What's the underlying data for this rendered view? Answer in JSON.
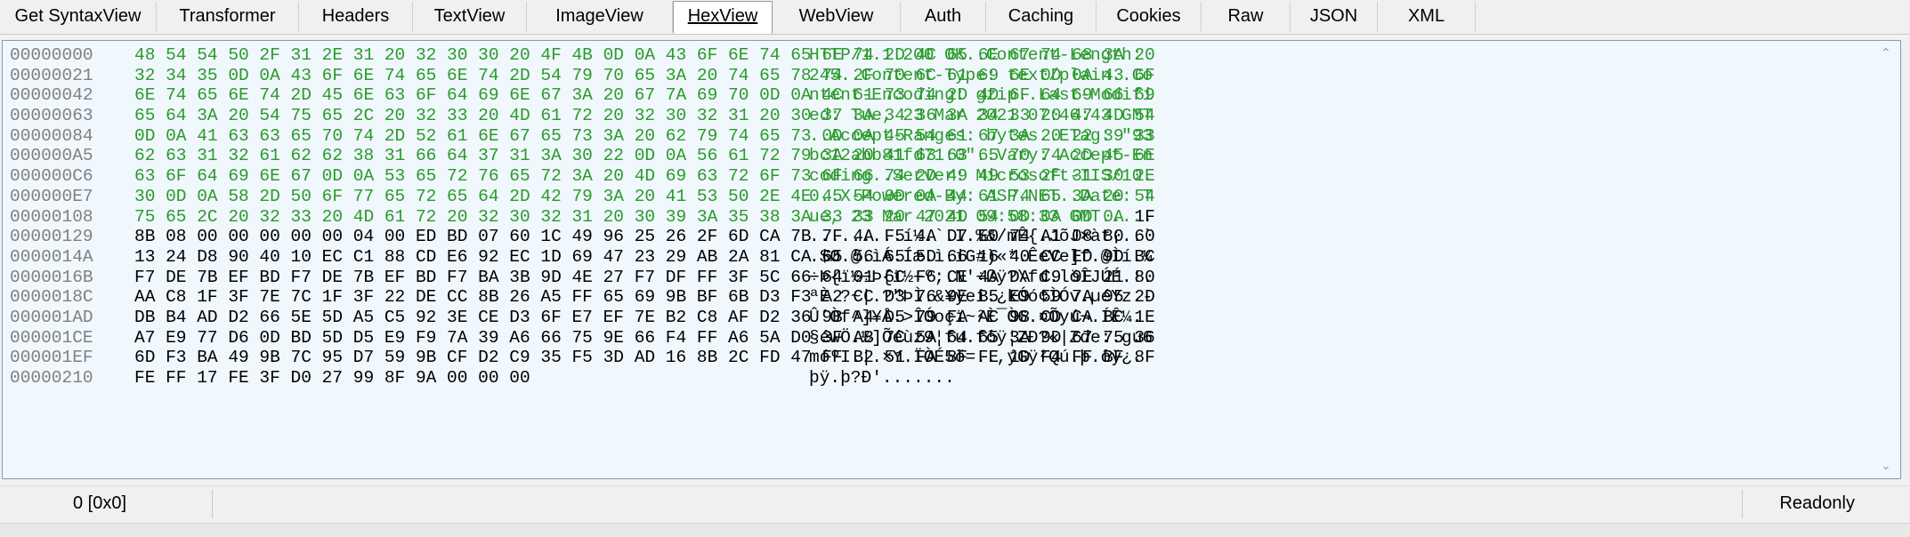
{
  "tabs": [
    {
      "label": "Get SyntaxView",
      "active": false
    },
    {
      "label": "Transformer",
      "active": false
    },
    {
      "label": "Headers",
      "active": false
    },
    {
      "label": "TextView",
      "active": false
    },
    {
      "label": "ImageView",
      "active": false
    },
    {
      "label": "HexView",
      "active": true
    },
    {
      "label": "WebView",
      "active": false
    },
    {
      "label": "Auth",
      "active": false
    },
    {
      "label": "Caching",
      "active": false
    },
    {
      "label": "Cookies",
      "active": false
    },
    {
      "label": "Raw",
      "active": false
    },
    {
      "label": "JSON",
      "active": false
    },
    {
      "label": "XML",
      "active": false
    }
  ],
  "colors": {
    "header_bytes": "#2a9a2a",
    "body_bytes": "#000000",
    "offset": "#808080",
    "panel_bg": "#f0f7fd"
  },
  "hex_rows": [
    {
      "offset": "00000000",
      "hex": "48 54 54 50 2F 31 2E 31 20 32 30 30 20 4F 4B 0D 0A 43 6F 6E 74 65 6E 74 2D 4C 65 6E 67 74 68 3A 20",
      "ascii": "HTTP/1.1 200 OK..Content-Length: ",
      "part": "hdr"
    },
    {
      "offset": "00000021",
      "hex": "32 34 35 0D 0A 43 6F 6E 74 65 6E 74 2D 54 79 70 65 3A 20 74 65 78 74 2F 70 6C 61 69 6E 0D 0A 43 6F",
      "ascii": "245..Content-Type: text/plain..Co",
      "part": "hdr"
    },
    {
      "offset": "00000042",
      "hex": "6E 74 65 6E 74 2D 45 6E 63 6F 64 69 6E 67 3A 20 67 7A 69 70 0D 0A 4C 61 73 74 2D 4D 6F 64 69 66 69",
      "ascii": "ntent-Encoding: gzip..Last-Modifi",
      "part": "hdr"
    },
    {
      "offset": "00000063",
      "hex": "65 64 3A 20 54 75 65 2C 20 32 33 20 4D 61 72 20 32 30 32 31 20 30 37 3A 34 36 3A 34 33 20 47 4D 54",
      "ascii": "ed: Tue, 23 Mar 2021 07:46:43 GMT",
      "part": "hdr"
    },
    {
      "offset": "00000084",
      "hex": "0D 0A 41 63 63 65 70 74 2D 52 61 6E 67 65 73 3A 20 62 79 74 65 73 0D 0A 45 54 61 67 3A 20 22 39 33",
      "ascii": "..Accept-Ranges: bytes..ETag: \"93",
      "part": "hdr"
    },
    {
      "offset": "000000A5",
      "hex": "62 63 31 32 61 62 62 38 31 66 64 37 31 3A 30 22 0D 0A 56 61 72 79 3A 20 41 63 63 65 70 74 2D 45 6E",
      "ascii": "bc12abb81fd71:0\"..Vary: Accept-En",
      "part": "hdr"
    },
    {
      "offset": "000000C6",
      "hex": "63 6F 64 69 6E 67 0D 0A 53 65 72 76 65 72 3A 20 4D 69 63 72 6F 73 6F 66 74 2D 49 49 53 2F 31 30 2E",
      "ascii": "coding..Server: Microsoft-IIS/10.",
      "part": "hdr"
    },
    {
      "offset": "000000E7",
      "hex": "30 0D 0A 58 2D 50 6F 77 65 72 65 64 2D 42 79 3A 20 41 53 50 2E 4E 45 54 0D 0A 44 61 74 65 3A 20 54",
      "ascii": "0..X-Powered-By: ASP.NET..Date: T",
      "part": "hdr"
    },
    {
      "offset": "00000108",
      "hex": "75 65 2C 20 32 33 20 4D 61 72 20 32 30 32 31 20 30 39 3A 35 38 3A 33 33 20 47 4D 54 0D 0A 0D 0A",
      "hex_body": " 1F",
      "ascii": "ue, 23 Mar 2021 09:58:33 GMT....",
      "ascii_body": ".",
      "part": "mixed"
    },
    {
      "offset": "00000129",
      "hex": "8B 08 00 00 00 00 00 04 00 ED BD 07 60 1C 49 96 25 26 2F 6D CA 7B 7F 4A F5 4A D7 E0 74 A1 08 80 60",
      "ascii": ".........í½.`.I.%&/mÊ{.JõJ×àt¡..`",
      "part": "body"
    },
    {
      "offset": "0000014A",
      "hex": "13 24 D8 90 40 10 EC C1 88 CD E6 92 EC 1D 69 47 23 29 AB 2A 81 CA 65 56 65 5D 66 16 40 CC ED 9D BC",
      "ascii": ".$Ø.@.ìÁ.Íæ.ì.iG#)«*.ÊeVe]f.@Ìí.¼",
      "part": "body"
    },
    {
      "offset": "0000016B",
      "hex": "F7 DE 7B EF BD F7 DE 7B EF BD F7 BA 3B 9D 4E 27 F7 DF FF 3F 5C 66 64 01 6C F6 CE 4A DA C9 9E 21 80",
      "ascii": "÷Þ{ï½÷Þ{ï½÷º;.N'÷ßÿ?\\fd.löÎJÚÉ.!.",
      "part": "body"
    },
    {
      "offset": "0000018C",
      "hex": "AA C8 1F 3F 7E 7C 1F 3F 22 DE CC 8B 26 A5 FF 65 69 9B BF 6B D3 F3 A2 CC D3 76 9E B5 E9 59 7A 95 2D",
      "ascii": "ªÈ.?~|.?\"ÞÌ.&¥ÿei.¿kÓó¢ÌÓv.µéYz.-",
      "part": "body"
    },
    {
      "offset": "000001AD",
      "hex": "DB B4 AD D2 66 5E 5D A5 C5 92 3E CE D3 6F E7 EF 7E B2 C8 AF D2 36 9B A4 D5 79 FA AC 98 CD CA BC 1E",
      "ascii": "Û´­Òf^]¥Å.>ÎÓoçï~²È¯Ò6.¤Õyú¬.ÍÊ¼.",
      "part": "body"
    },
    {
      "offset": "000001CE",
      "hex": "A7 E9 77 D6 0D BD 5D D5 E9 F9 7A 39 A6 66 75 9E 66 F4 FF A6 5A D0 3F AB 7C 5A 64 65 3A 9D 67 75 36",
      "ascii": "§éwÖ.½]Õéùz9¦fu.fôÿ¦ZÐ?«|Zde:.gu6",
      "part": "body"
    },
    {
      "offset": "000001EF",
      "hex": "6D F3 BA 49 9B 7C 95 D7 59 9B CF D2 C9 35 F5 3D AD 16 8B 2C FD 47 FF B2 51 FA 8F FE 1D F4 FF BF 8F",
      "ascii": "móºI.|.×Y.ÏÒÉ5õ=­..,ýGÿ²Qú.þ.ôÿ¿.",
      "part": "body"
    },
    {
      "offset": "00000210",
      "hex": "FE FF 17 FE 3F D0 27 99 8F 9A 00 00 00",
      "ascii": "þÿ.þ?Ð'.......",
      "part": "body"
    }
  ],
  "status": {
    "position": "0 [0x0]",
    "mode": "Readonly"
  }
}
